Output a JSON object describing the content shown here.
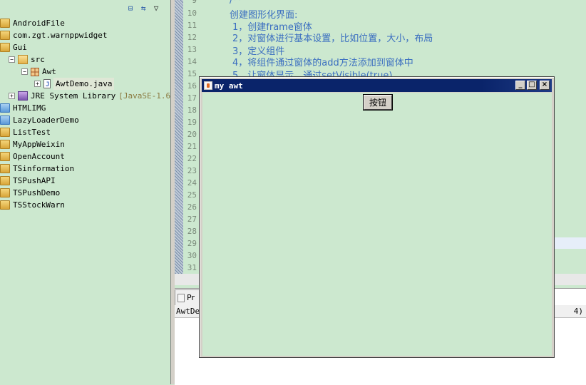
{
  "explorer": {
    "items": [
      {
        "label": "AndroidFile",
        "icon": "project-icon"
      },
      {
        "label": "com.zgt.warnppwidget",
        "icon": "project-icon"
      },
      {
        "label": "Gui",
        "icon": "project-icon"
      },
      {
        "label": "src",
        "icon": "source-folder-icon"
      },
      {
        "label": "Awt",
        "icon": "package-icon"
      },
      {
        "label": "AwtDemo.java",
        "icon": "java-file-icon"
      },
      {
        "label": "JRE System Library",
        "version": "[JavaSE-1.6]",
        "icon": "library-icon"
      },
      {
        "label": "HTMLIMG",
        "icon": "folder-icon"
      },
      {
        "label": "LazyLoaderDemo",
        "icon": "folder-icon"
      },
      {
        "label": "ListTest",
        "icon": "project-icon"
      },
      {
        "label": "MyAppWeixin",
        "icon": "project-icon"
      },
      {
        "label": "OpenAccount",
        "icon": "project-icon"
      },
      {
        "label": "TSinformation",
        "icon": "project-icon"
      },
      {
        "label": "TSPushAPI",
        "icon": "project-icon"
      },
      {
        "label": "TSPushDemo",
        "icon": "project-icon"
      },
      {
        "label": "TSStockWarn",
        "icon": "project-icon"
      }
    ]
  },
  "editor": {
    "line_numbers": [
      "9",
      "10",
      "11",
      "12",
      "13",
      "14",
      "15",
      "16",
      "17",
      "18",
      "19",
      "20",
      "21",
      "22",
      "23",
      "24",
      "25",
      "26",
      "27",
      "28",
      "29",
      "30",
      "31"
    ],
    "code_lines": [
      "/**",
      "创建图形化界面:",
      "1，创建frame窗体",
      "2，对窗体进行基本设置，比如位置，大小，布局",
      "3，定义组件",
      "4，将组件通过窗体的add方法添加到窗体中",
      "5，让窗体显示，通过setVisible(true)"
    ]
  },
  "bottom_panel": {
    "tab_label": "Pr",
    "status_left": "AwtDe",
    "status_right": "4)"
  },
  "awt_window": {
    "title": "my awt",
    "button_label": "按钮",
    "minimize": "_",
    "maximize": "□",
    "close": "×"
  },
  "colors": {
    "background": "#cce8cf",
    "titlebar": "#0a246a",
    "code_text": "#3a6ec0"
  }
}
